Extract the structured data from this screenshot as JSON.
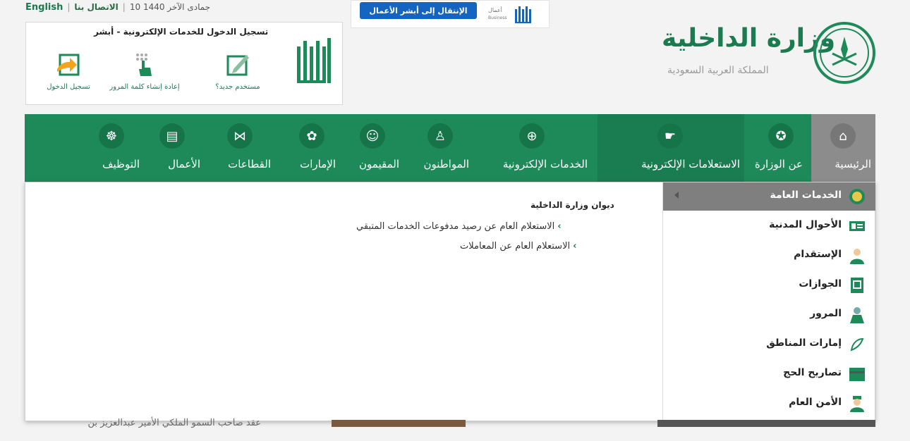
{
  "topbar": {
    "language": "English",
    "contact": "الاتصال بنا",
    "date": "10 جمادى الآخر 1440"
  },
  "business": {
    "button_label": "الإنتقال إلى أبشر الأعمال",
    "logo_text": "أعمال Business"
  },
  "login": {
    "title": "تسجيل الدخول للخدمات الإلكترونية - أبشر",
    "actions": [
      {
        "label": "مستخدم جديد؟",
        "icon": "new-user-icon"
      },
      {
        "label": "إعادة إنشاء كلمة المرور",
        "icon": "password-reset-icon"
      },
      {
        "label": "تسجيل الدخول",
        "icon": "login-icon"
      }
    ]
  },
  "ministry": {
    "title": "وزارة الداخلية",
    "subtitle": "المملكة العربية السعودية"
  },
  "nav": {
    "items": [
      {
        "label": "الرئيسية",
        "icon": "home-icon"
      },
      {
        "label": "عن الوزارة",
        "icon": "ministry-emblem-icon"
      },
      {
        "label": "الاستعلامات الإلكترونية",
        "icon": "globe-hand-icon"
      },
      {
        "label": "الخدمات الإلكترونية",
        "icon": "globe-icon"
      },
      {
        "label": "المواطنون",
        "icon": "citizen-icon"
      },
      {
        "label": "المقيمون",
        "icon": "residents-icon"
      },
      {
        "label": "الإمارات",
        "icon": "emirates-icon"
      },
      {
        "label": "القطاعات",
        "icon": "sectors-icon"
      },
      {
        "label": "الأعمال",
        "icon": "briefcase-icon"
      },
      {
        "label": "التوظيف",
        "icon": "employment-icon"
      }
    ]
  },
  "dropdown": {
    "side_items": [
      {
        "label": "الخدمات العامة",
        "icon": "emblem-icon"
      },
      {
        "label": "الأحوال المدنية",
        "icon": "id-card-icon"
      },
      {
        "label": "الإستقدام",
        "icon": "worker-icon"
      },
      {
        "label": "الجوازات",
        "icon": "passport-icon"
      },
      {
        "label": "المرور",
        "icon": "traffic-icon"
      },
      {
        "label": "إمارات المناطق",
        "icon": "regions-icon"
      },
      {
        "label": "تصاريح الحج",
        "icon": "kaaba-icon"
      },
      {
        "label": "الأمن العام",
        "icon": "police-icon"
      }
    ],
    "section_title": "ديوان وزارة الداخلية",
    "links": [
      "الاستعلام العام عن رصيد مدفوعات الخدمات المتبقي",
      "الاستعلام العام عن المعاملات"
    ]
  },
  "behind": {
    "news_text": "عقد صاحب السمو الملكي الأمير عبدالعزيز بن"
  },
  "colors": {
    "brand_green": "#1e8a5a",
    "home_gray": "#8c8c8c",
    "absher_blue": "#1565c0"
  }
}
